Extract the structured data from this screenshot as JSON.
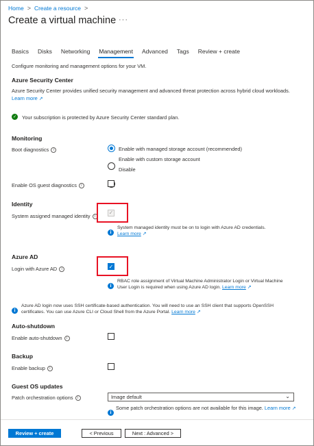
{
  "breadcrumb": {
    "home": "Home",
    "create_resource": "Create a resource",
    "separator": ">"
  },
  "page_title": "Create a virtual machine",
  "more_label": "···",
  "tabs": [
    {
      "label": "Basics",
      "active": false
    },
    {
      "label": "Disks",
      "active": false
    },
    {
      "label": "Networking",
      "active": false
    },
    {
      "label": "Management",
      "active": true
    },
    {
      "label": "Advanced",
      "active": false
    },
    {
      "label": "Tags",
      "active": false
    },
    {
      "label": "Review + create",
      "active": false
    }
  ],
  "description": "Configure monitoring and management options for your VM.",
  "security_center": {
    "heading": "Azure Security Center",
    "text": "Azure Security Center provides unified security management and advanced threat protection across hybrid cloud workloads.",
    "learn_more": "Learn more",
    "status": "Your subscription is protected by Azure Security Center standard plan."
  },
  "monitoring": {
    "heading": "Monitoring",
    "boot_label": "Boot diagnostics",
    "options": [
      "Enable with managed storage account (recommended)",
      "Enable with custom storage account",
      "Disable"
    ],
    "selected_option": "Enable with managed storage account (recommended)",
    "os_guest_label": "Enable OS guest diagnostics"
  },
  "identity": {
    "heading": "Identity",
    "label": "System assigned managed identity",
    "checked": true,
    "disabled": true,
    "note": "System managed identity must be on to login with Azure AD credentials.",
    "learn_more": "Learn more"
  },
  "azure_ad": {
    "heading": "Azure AD",
    "label": "Login with Azure AD",
    "checked": true,
    "note_line1": "RBAC role assignment of Virtual Machine Administrator Login or Virtual Machine",
    "note_line2": "User Login is required when using Azure AD login.",
    "learn_more": "Learn more",
    "ssh_note_line1": "Azure AD login now uses SSH certificate-based authentication. You will need to use an SSH client that supports OpenSSH",
    "ssh_note_line2": "certificates. You can use Azure CLI or Cloud Shell from the Azure Portal.",
    "ssh_learn_more": "Learn more"
  },
  "auto_shutdown": {
    "heading": "Auto-shutdown",
    "label": "Enable auto-shutdown"
  },
  "backup": {
    "heading": "Backup",
    "label": "Enable backup"
  },
  "guest_os": {
    "heading": "Guest OS updates",
    "label": "Patch orchestration options",
    "selected": "Image default",
    "note": "Some patch orchestration options are not available for this image.",
    "learn_more": "Learn more"
  },
  "footer": {
    "review_create": "Review + create",
    "previous": "< Previous",
    "next": "Next : Advanced >"
  },
  "colors": {
    "accent": "#0078d4",
    "success": "#107c10",
    "highlight": "#e81123"
  },
  "icons": [
    "chevron-right-icon",
    "more-icon",
    "external-link-icon",
    "checkmark-circle-icon",
    "info-icon",
    "chevron-down-icon"
  ]
}
